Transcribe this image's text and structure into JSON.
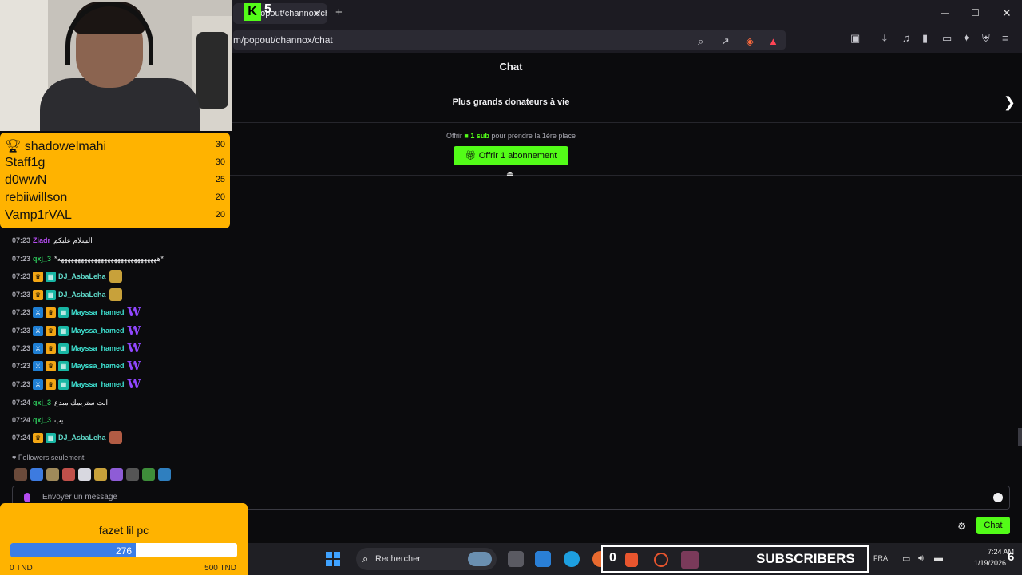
{
  "browser": {
    "tab_title": "popout/channox/chat",
    "url": "m/popout/channox/chat",
    "kick_logo": "K",
    "kick_count": "5",
    "new_tab": "+",
    "tab_close": "✕",
    "minimize": "─",
    "maximize": "☐",
    "close": "✕"
  },
  "chat": {
    "title": "Chat",
    "top_donors_label": "Plus grands donateurs à vie",
    "promo_prefix": "Offrir",
    "promo_bold": "1 sub",
    "promo_suffix": "pour prendre la 1ère place",
    "gift_button": "Offrir 1 abonnement",
    "followers_only": "Followers seulement",
    "input_placeholder": "Envoyer un message",
    "send_button": "Chat",
    "messages": [
      {
        "time": "07:23",
        "user": "Ziadr",
        "text": "السلام عليكم"
      },
      {
        "time": "07:23",
        "user": "qxj_3",
        "text": "*ههههههههههههههههههههههههههههههه*"
      },
      {
        "time": "07:23",
        "user": "DJ_AsbaLeha",
        "text": ""
      },
      {
        "time": "07:23",
        "user": "DJ_AsbaLeha",
        "text": ""
      },
      {
        "time": "07:23",
        "user": "Mayssa_hamed",
        "text": ""
      },
      {
        "time": "07:23",
        "user": "Mayssa_hamed",
        "text": ""
      },
      {
        "time": "07:23",
        "user": "Mayssa_hamed",
        "text": ""
      },
      {
        "time": "07:23",
        "user": "Mayssa_hamed",
        "text": ""
      },
      {
        "time": "07:23",
        "user": "Mayssa_hamed",
        "text": ""
      },
      {
        "time": "07:24",
        "user": "qxj_3",
        "text": "انت ستريمك مبدع"
      },
      {
        "time": "07:24",
        "user": "qxj_3",
        "text": "يب"
      },
      {
        "time": "07:24",
        "user": "DJ_AsbaLeha",
        "text": ""
      }
    ]
  },
  "top_donors": [
    {
      "name": "shadowelmahi",
      "value": "30"
    },
    {
      "name": "Staff1g",
      "value": "30"
    },
    {
      "name": "d0wwN",
      "value": "25"
    },
    {
      "name": "rebiiwillson",
      "value": "20"
    },
    {
      "name": "Vamp1rVAL",
      "value": "20"
    }
  ],
  "goal": {
    "title": "fazet lil pc",
    "current": "276",
    "min": "0 TND",
    "max": "500 TND",
    "progress": 0.552
  },
  "taskbar": {
    "search": "Rechercher",
    "subs_count": "0",
    "subs_label": "SUBSCRIBERS",
    "lang": "FRA",
    "time": "7:24 AM",
    "date": "1/19/2026",
    "notif": "6"
  },
  "colors": {
    "kick_green": "#53fc18",
    "overlay_yellow": "#ffb300",
    "goal_blue": "#3b7ee8"
  }
}
